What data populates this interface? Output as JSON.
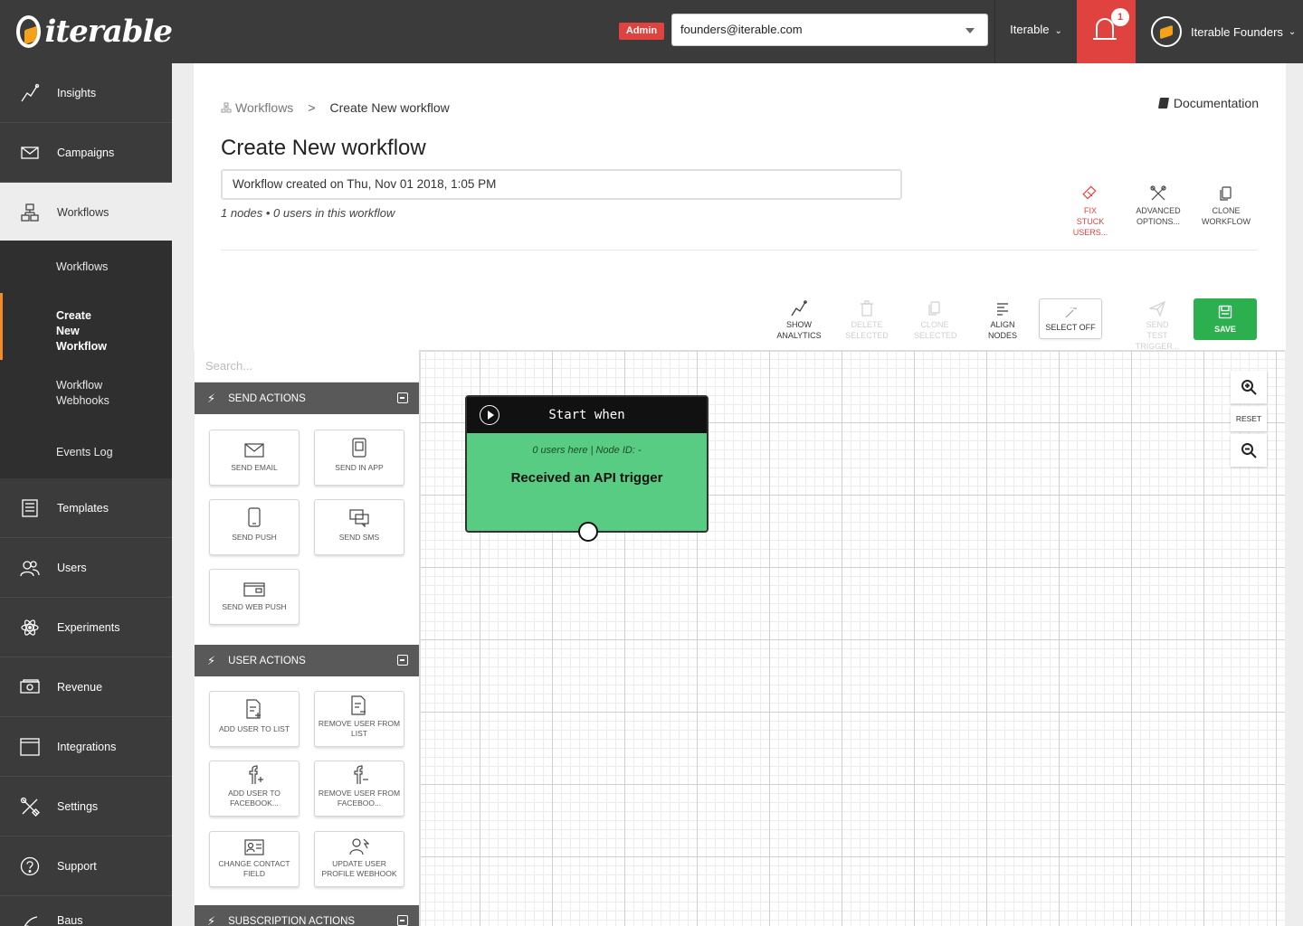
{
  "brand": {
    "name": "iterable"
  },
  "topbar": {
    "admin_badge": "Admin",
    "org_email": "founders@iterable.com",
    "project_label": "Iterable",
    "notification_count": "1",
    "user_label": "Iterable Founders"
  },
  "sidebar": {
    "items": [
      {
        "label": "Insights",
        "icon": "chart-line-icon"
      },
      {
        "label": "Campaigns",
        "icon": "envelope-icon"
      },
      {
        "label": "Workflows",
        "icon": "workflow-icon"
      },
      {
        "label": "Templates",
        "icon": "template-icon"
      },
      {
        "label": "Users",
        "icon": "users-icon"
      },
      {
        "label": "Experiments",
        "icon": "atom-icon"
      },
      {
        "label": "Revenue",
        "icon": "revenue-icon"
      },
      {
        "label": "Integrations",
        "icon": "integrations-icon"
      },
      {
        "label": "Settings",
        "icon": "tools-icon"
      },
      {
        "label": "Support",
        "icon": "question-icon"
      },
      {
        "label": "Baus",
        "icon": "baus-icon"
      }
    ],
    "sub_items": [
      {
        "label": "Workflows"
      },
      {
        "label": "Create New Workflow"
      },
      {
        "label": "Workflow Webhooks"
      },
      {
        "label": "Events Log"
      }
    ]
  },
  "breadcrumb": {
    "root": "Workflows",
    "separator": ">",
    "current": "Create New workflow"
  },
  "documentation_link": "Documentation",
  "page_title": "Create New workflow",
  "workflow_description": "Workflow created on Thu, Nov 01 2018, 1:05 PM",
  "workflow_meta": "1 nodes • 0 users in this workflow",
  "header_actions": {
    "fix_stuck": "Fix stuck users...",
    "advanced": "Advanced options...",
    "clone_workflow": "Clone workflow"
  },
  "toolbar": {
    "show_analytics": "Show analytics",
    "delete_selected": "Delete selected",
    "clone_selected": "Clone selected",
    "align_nodes": "Align nodes",
    "select_off": "Select off",
    "send_test": "Send test trigger...",
    "save": "Save"
  },
  "palette": {
    "search_placeholder": "Search...",
    "send_actions": {
      "title": "Send Actions",
      "tiles": [
        "Send email",
        "Send in app",
        "Send push",
        "Send SMS",
        "Send web push"
      ]
    },
    "user_actions": {
      "title": "User Actions",
      "tiles": [
        "Add user to list",
        "Remove user from list",
        "Add user to Facebook...",
        "Remove user from Faceboo...",
        "Change contact field",
        "Update user profile webhook"
      ]
    },
    "subscription_actions": {
      "title": "Subscription Actions"
    }
  },
  "node": {
    "header": "Start when",
    "meta": "0 users here | Node ID: -",
    "body": "Received an API trigger",
    "color": "#57cc82"
  },
  "zoom": {
    "reset": "Reset"
  },
  "colors": {
    "accent_red": "#e0433f",
    "save_green": "#2cb04f",
    "sidebar_bg": "#3b3b3b",
    "active_indicator": "#f28c28"
  }
}
